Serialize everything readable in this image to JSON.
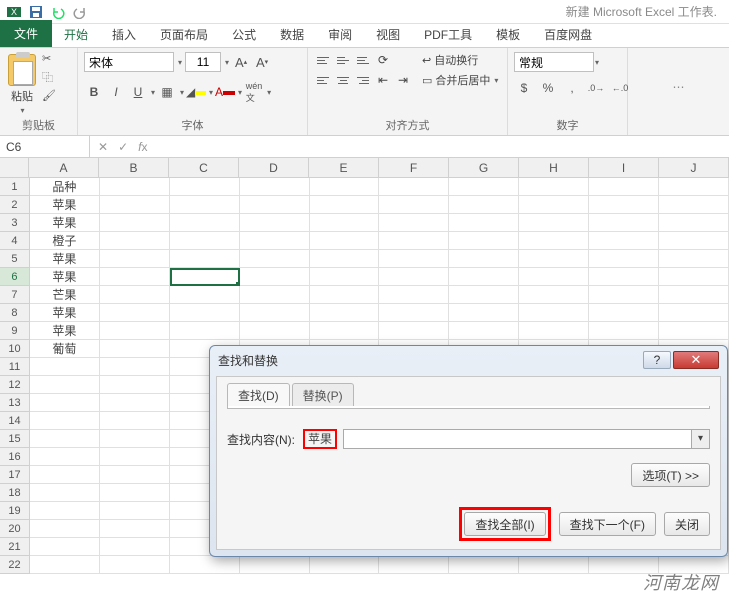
{
  "app": {
    "title": "新建 Microsoft Excel 工作表."
  },
  "tabs": {
    "file": "文件",
    "home": "开始",
    "insert": "插入",
    "layout": "页面布局",
    "formulas": "公式",
    "data": "数据",
    "review": "审阅",
    "view": "视图",
    "pdf": "PDF工具",
    "template": "模板",
    "baidu": "百度网盘"
  },
  "ribbon": {
    "clipboard": {
      "label": "剪贴板",
      "paste": "粘贴"
    },
    "font": {
      "label": "字体",
      "name": "宋体",
      "size": "11"
    },
    "alignment": {
      "label": "对齐方式",
      "wrap": "自动换行",
      "merge": "合并后居中"
    },
    "number": {
      "label": "数字",
      "format": "常规"
    }
  },
  "namebox": "C6",
  "columns": [
    "A",
    "B",
    "C",
    "D",
    "E",
    "F",
    "G",
    "H",
    "I",
    "J"
  ],
  "rows_data": [
    {
      "n": 1,
      "a": "品种"
    },
    {
      "n": 2,
      "a": "苹果"
    },
    {
      "n": 3,
      "a": "苹果"
    },
    {
      "n": 4,
      "a": "橙子"
    },
    {
      "n": 5,
      "a": "苹果"
    },
    {
      "n": 6,
      "a": "苹果"
    },
    {
      "n": 7,
      "a": "芒果"
    },
    {
      "n": 8,
      "a": "苹果"
    },
    {
      "n": 9,
      "a": "苹果"
    },
    {
      "n": 10,
      "a": "葡萄"
    },
    {
      "n": 11,
      "a": ""
    },
    {
      "n": 12,
      "a": ""
    },
    {
      "n": 13,
      "a": ""
    },
    {
      "n": 14,
      "a": ""
    },
    {
      "n": 15,
      "a": ""
    },
    {
      "n": 16,
      "a": ""
    },
    {
      "n": 17,
      "a": ""
    },
    {
      "n": 18,
      "a": ""
    },
    {
      "n": 19,
      "a": ""
    },
    {
      "n": 20,
      "a": ""
    },
    {
      "n": 21,
      "a": ""
    },
    {
      "n": 22,
      "a": ""
    }
  ],
  "dialog": {
    "title": "查找和替换",
    "tab_find": "查找(D)",
    "tab_replace": "替换(P)",
    "find_label": "查找内容(N):",
    "find_value": "苹果",
    "options": "选项(T) >>",
    "find_all": "查找全部(I)",
    "find_next": "查找下一个(F)",
    "close": "关闭",
    "help": "?"
  },
  "watermark": "河南龙网"
}
